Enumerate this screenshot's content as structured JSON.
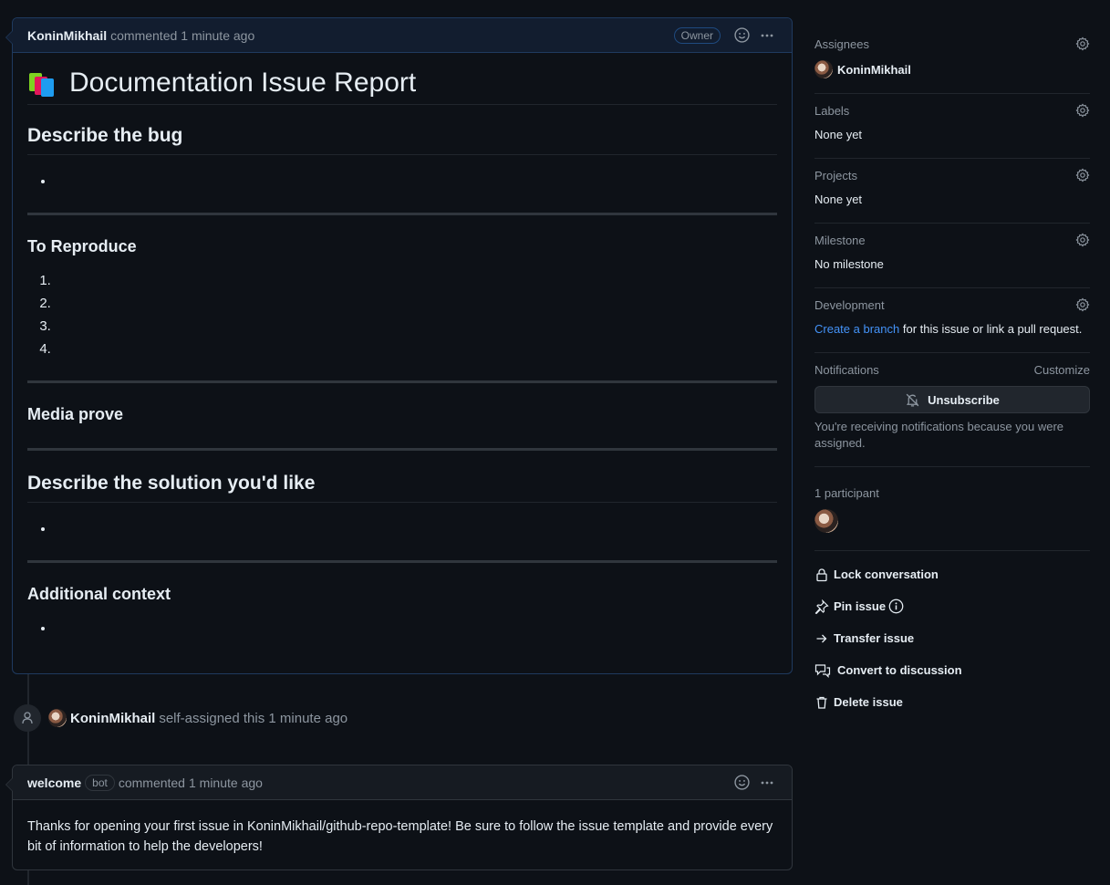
{
  "issue_comment": {
    "author": "KoninMikhail",
    "action": "commented",
    "time": "1 minute ago",
    "badge": "Owner",
    "title": "Documentation Issue Report",
    "title_icon": "books-icon",
    "sections": {
      "bug_heading": "Describe the bug",
      "reproduce_heading": "To Reproduce",
      "reproduce_steps": [
        "",
        "",
        "",
        ""
      ],
      "media_heading": "Media prove",
      "solution_heading": "Describe the solution you'd like",
      "context_heading": "Additional context"
    }
  },
  "event": {
    "icon": "person-icon",
    "author": "KoninMikhail",
    "text": "self-assigned this 1 minute ago"
  },
  "bot_comment": {
    "author": "welcome",
    "badge": "bot",
    "action": "commented",
    "time": "1 minute ago",
    "body": "Thanks for opening your first issue in KoninMikhail/github-repo-template! Be sure to follow the issue template and provide every bit of information to help the developers!"
  },
  "sidebar": {
    "assignees": {
      "label": "Assignees",
      "value": "KoninMikhail"
    },
    "labels": {
      "label": "Labels",
      "value": "None yet"
    },
    "projects": {
      "label": "Projects",
      "value": "None yet"
    },
    "milestone": {
      "label": "Milestone",
      "value": "No milestone"
    },
    "development": {
      "label": "Development",
      "link": "Create a branch",
      "text": " for this issue or link a pull request."
    },
    "notifications": {
      "label": "Notifications",
      "customize": "Customize",
      "button": "Unsubscribe",
      "note": "You're receiving notifications because you were assigned."
    },
    "participants": {
      "label": "1 participant"
    },
    "actions": {
      "lock": "Lock conversation",
      "pin": "Pin issue",
      "transfer": "Transfer issue",
      "convert": "Convert to discussion",
      "delete": "Delete issue"
    }
  },
  "colors": {
    "background": "#0d1117",
    "accent_link": "#4493f8",
    "owner_header": "#121d2f"
  }
}
